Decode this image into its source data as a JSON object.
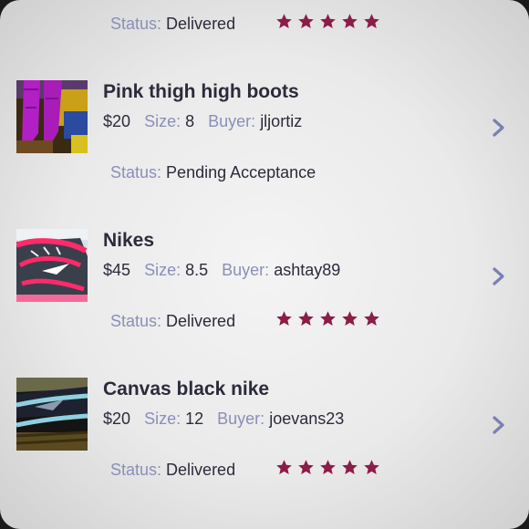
{
  "orders": [
    {
      "status_label": "Status:",
      "status_value": "Delivered",
      "rating": 5
    },
    {
      "title": "Pink thigh high boots",
      "price": "$20",
      "size_label": "Size:",
      "size": "8",
      "buyer_label": "Buyer:",
      "buyer": "jljortiz",
      "status_label": "Status:",
      "status_value": "Pending Acceptance",
      "thumb_icon": "pink-boots-photo"
    },
    {
      "title": "Nikes",
      "price": "$45",
      "size_label": "Size:",
      "size": "8.5",
      "buyer_label": "Buyer:",
      "buyer": "ashtay89",
      "status_label": "Status:",
      "status_value": "Delivered",
      "rating": 5,
      "thumb_icon": "pink-nike-shoes-photo"
    },
    {
      "title": "Canvas black nike",
      "price": "$20",
      "size_label": "Size:",
      "size": "12",
      "buyer_label": "Buyer:",
      "buyer": "joevans23",
      "status_label": "Status:",
      "status_value": "Delivered",
      "rating": 5,
      "thumb_icon": "black-nike-shoes-photo"
    }
  ],
  "colors": {
    "title": "#2b2b3c",
    "label": "#8a8fb8",
    "star": "#8b1d48",
    "chevron": "#7a80b0"
  },
  "icons": {
    "star": "star-icon",
    "chevron": "chevron-right-icon"
  }
}
